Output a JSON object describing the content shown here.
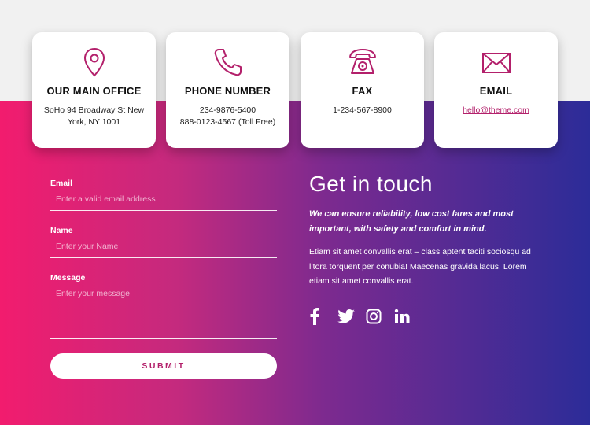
{
  "cards": [
    {
      "title": "OUR MAIN OFFICE",
      "lines": [
        "SoHo 94 Broadway St New",
        "York, NY 1001"
      ],
      "icon": "map-pin-icon"
    },
    {
      "title": "PHONE NUMBER",
      "lines": [
        "234-9876-5400",
        "888-0123-4567 (Toll Free)"
      ],
      "icon": "phone-icon"
    },
    {
      "title": "FAX",
      "lines": [
        "1-234-567-8900"
      ],
      "icon": "fax-icon"
    },
    {
      "title": "EMAIL",
      "lines": [
        "hello@theme.com"
      ],
      "icon": "mail-icon"
    }
  ],
  "form": {
    "email_label": "Email",
    "email_placeholder": "Enter a valid email address",
    "name_label": "Name",
    "name_placeholder": "Enter your Name",
    "message_label": "Message",
    "message_placeholder": "Enter your message",
    "submit_label": "SUBMIT"
  },
  "info": {
    "heading": "Get in touch",
    "lead": "We can ensure reliability, low cost fares and most important, with safety and comfort in mind.",
    "body": "Etiam sit amet convallis erat – class aptent taciti sociosqu ad litora torquent per conubia! Maecenas gravida lacus. Lorem etiam sit amet convallis erat."
  },
  "social": [
    "facebook-icon",
    "twitter-icon",
    "instagram-icon",
    "linkedin-icon"
  ],
  "colors": {
    "accent": "#b3206b",
    "gradient_start": "#f21c6e",
    "gradient_end": "#2c2c98"
  }
}
